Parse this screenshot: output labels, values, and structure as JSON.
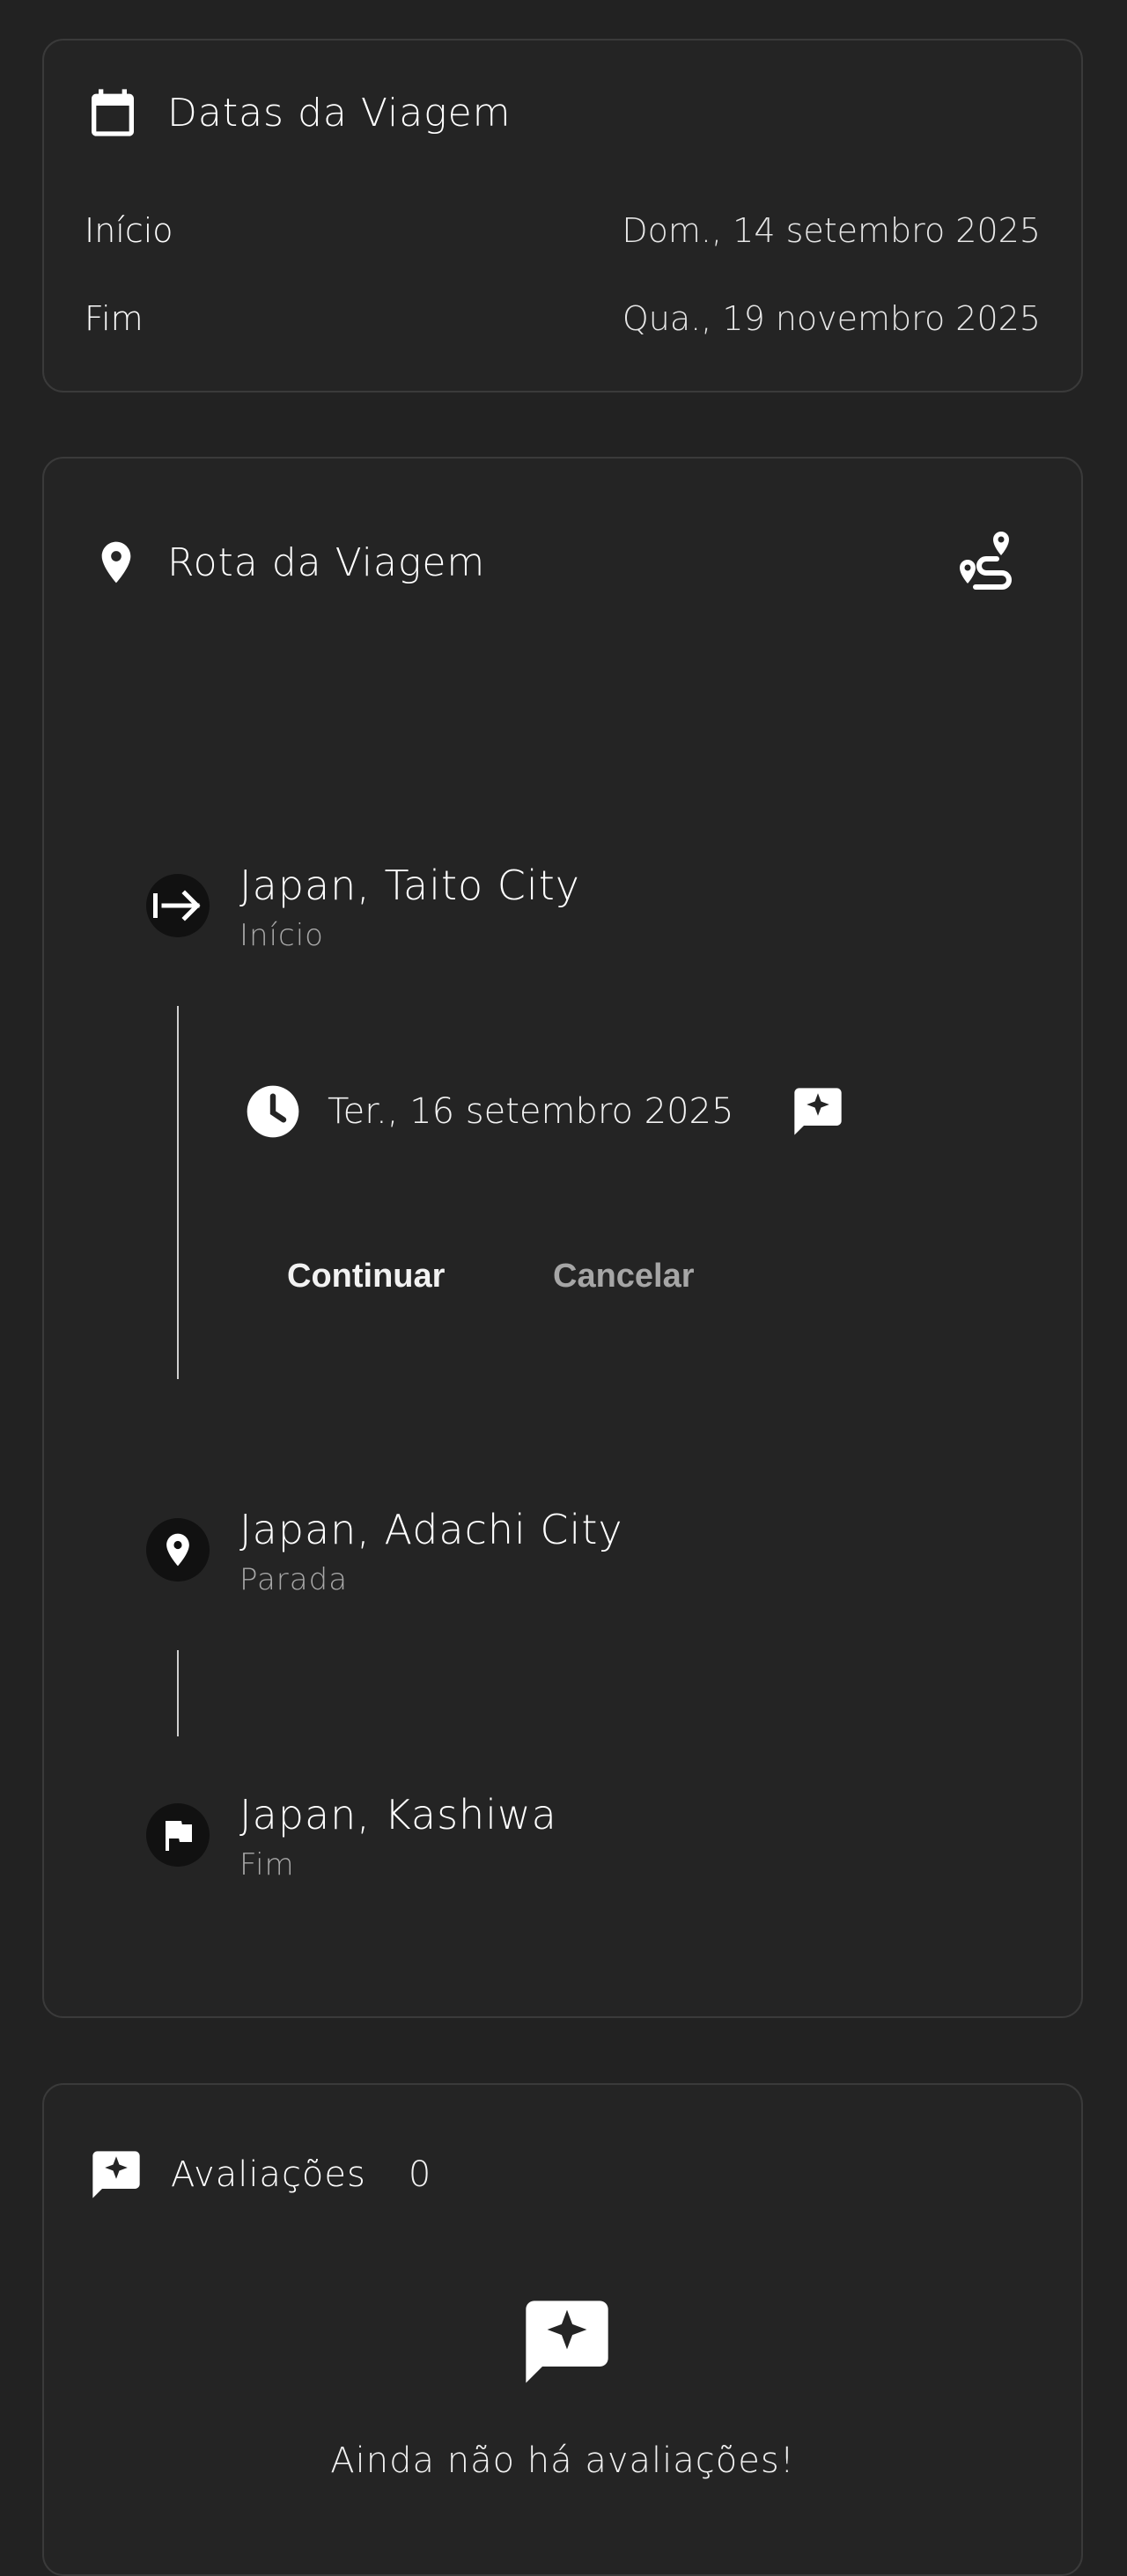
{
  "trip_dates": {
    "title": "Datas da Viagem",
    "icon": "calendar-icon",
    "start_label": "Início",
    "start_value": "Dom., 14 setembro 2025",
    "end_label": "Fim",
    "end_value": "Qua., 19 novembro 2025"
  },
  "route": {
    "title": "Rota da Viagem",
    "icon": "location-pin-icon",
    "action_icon": "route-icon",
    "stops": [
      {
        "name": "Japan, Taito City",
        "type": "Início",
        "icon": "start-arrow-icon"
      },
      {
        "name": "Japan, Adachi City",
        "type": "Parada",
        "icon": "location-pin-icon"
      },
      {
        "name": "Japan, Kashiwa",
        "type": "Fim",
        "icon": "flag-icon"
      }
    ],
    "leg": {
      "date": "Ter., 16 setembro 2025",
      "date_icon": "clock-icon",
      "review_icon": "review-sparkle-icon"
    },
    "continue_label": "Continuar",
    "cancel_label": "Cancelar"
  },
  "reviews": {
    "title": "Avaliações",
    "count": "0",
    "icon": "review-sparkle-icon",
    "empty_message": "Ainda não há avaliações!"
  },
  "colors": {
    "background": "#222222",
    "card": "#242424",
    "border": "#3a3a3a",
    "text": "#ffffff",
    "muted": "#a8a8a8"
  }
}
